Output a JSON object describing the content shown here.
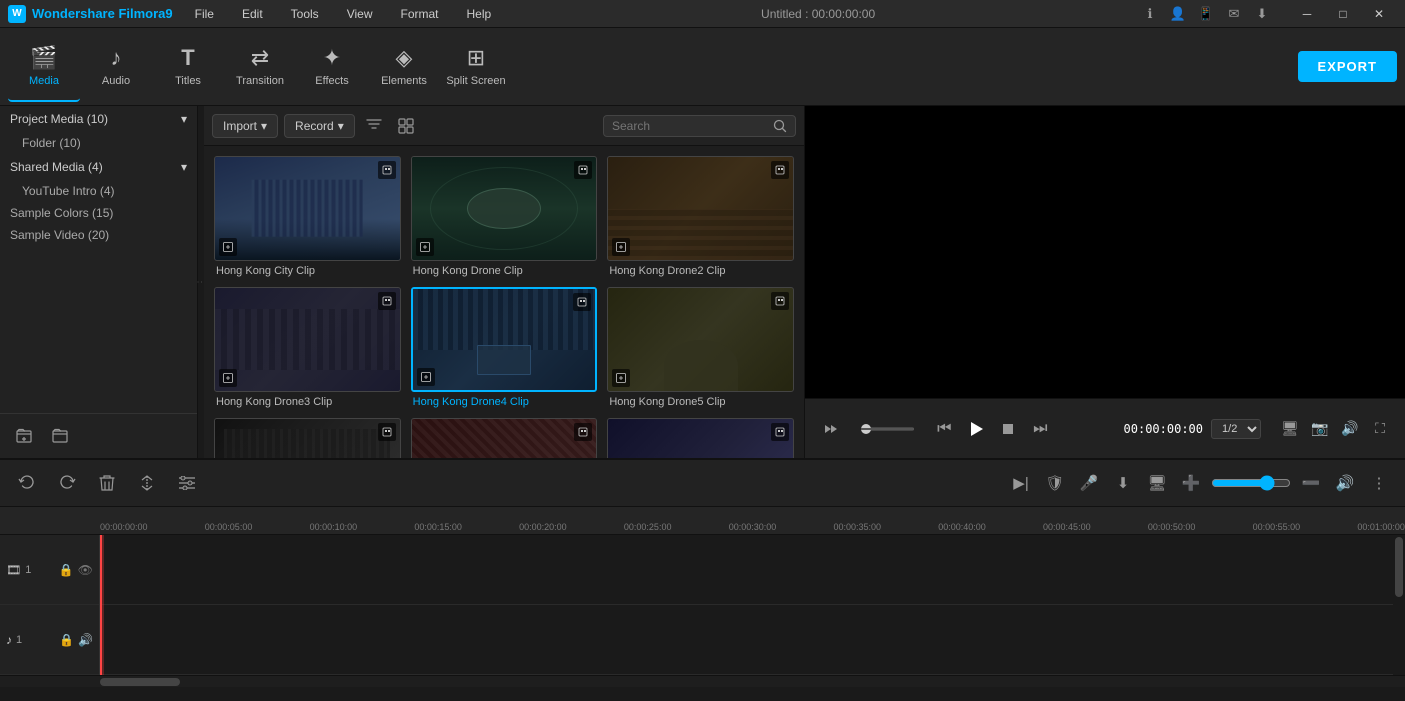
{
  "app": {
    "name": "Wondershare Filmora9",
    "title": "Untitled : 00:00:00:00"
  },
  "menu": {
    "items": [
      "File",
      "Edit",
      "Tools",
      "View",
      "Format",
      "Help"
    ]
  },
  "window_controls": {
    "minimize": "─",
    "maximize": "□",
    "close": "✕"
  },
  "toolbar": {
    "items": [
      {
        "id": "media",
        "label": "Media",
        "icon": "🎬",
        "active": true
      },
      {
        "id": "audio",
        "label": "Audio",
        "icon": "♪",
        "active": false
      },
      {
        "id": "titles",
        "label": "Titles",
        "icon": "T",
        "active": false
      },
      {
        "id": "transition",
        "label": "Transition",
        "icon": "⇄",
        "active": false
      },
      {
        "id": "effects",
        "label": "Effects",
        "icon": "✦",
        "active": false
      },
      {
        "id": "elements",
        "label": "Elements",
        "icon": "◈",
        "active": false
      },
      {
        "id": "splitscreen",
        "label": "Split Screen",
        "icon": "⊞",
        "active": false
      }
    ],
    "export_label": "EXPORT"
  },
  "sidebar": {
    "sections": [
      {
        "id": "project-media",
        "label": "Project Media (10)",
        "expanded": true,
        "sub_items": [
          {
            "id": "folder",
            "label": "Folder (10)"
          }
        ]
      },
      {
        "id": "shared-media",
        "label": "Shared Media (4)",
        "expanded": true,
        "sub_items": [
          {
            "id": "youtube-intro",
            "label": "YouTube Intro (4)"
          }
        ]
      },
      {
        "id": "sample-colors",
        "label": "Sample Colors (15)",
        "expanded": false,
        "sub_items": []
      },
      {
        "id": "sample-video",
        "label": "Sample Video (20)",
        "expanded": false,
        "sub_items": []
      }
    ],
    "footer_btns": [
      {
        "id": "add-folder",
        "icon": "+"
      },
      {
        "id": "remove-folder",
        "icon": "📁"
      }
    ]
  },
  "media_toolbar": {
    "import_label": "Import",
    "record_label": "Record",
    "search_placeholder": "Search",
    "filter_icon": "filter",
    "layout_icon": "grid"
  },
  "media_grid": {
    "items": [
      {
        "id": "city-clip",
        "label": "Hong Kong City Clip",
        "active": false
      },
      {
        "id": "drone-clip",
        "label": "Hong Kong Drone Clip",
        "active": false
      },
      {
        "id": "drone2-clip",
        "label": "Hong Kong Drone2 Clip",
        "active": false
      },
      {
        "id": "drone3-clip",
        "label": "Hong Kong Drone3 Clip",
        "active": false
      },
      {
        "id": "drone4-clip",
        "label": "Hong Kong Drone4 Clip",
        "active": true
      },
      {
        "id": "drone5-clip",
        "label": "Hong Kong Drone5 Clip",
        "active": false
      },
      {
        "id": "row3a",
        "label": "",
        "active": false
      },
      {
        "id": "row3b",
        "label": "",
        "active": false
      },
      {
        "id": "row3c",
        "label": "",
        "active": false
      }
    ]
  },
  "preview": {
    "time": "00:00:00:00",
    "zoom": "1/2",
    "controls": {
      "prev": "⏮",
      "step_back": "⏭",
      "play": "▶",
      "stop": "■",
      "step_fwd": "⏭"
    }
  },
  "action_bar": {
    "undo": "↩",
    "redo": "↪",
    "delete": "🗑",
    "split": "✂",
    "adjust": "≡",
    "right_icons": [
      "▶|",
      "🛡",
      "🎤",
      "⬇",
      "🖥",
      "➕",
      "➖",
      "🔊"
    ]
  },
  "timeline": {
    "ruler_marks": [
      "00:00:00:00",
      "00:00:05:00",
      "00:00:10:00",
      "00:00:15:00",
      "00:00:20:00",
      "00:00:25:00",
      "00:00:30:00",
      "00:00:35:00",
      "00:00:40:00",
      "00:00:45:00",
      "00:00:50:00",
      "00:00:55:00",
      "00:01:00:00"
    ],
    "tracks": [
      {
        "id": "video-1",
        "type": "video",
        "label": "1",
        "icon": "🎞",
        "controls": [
          "🔒",
          "👁"
        ]
      },
      {
        "id": "audio-1",
        "type": "audio",
        "label": "1",
        "icon": "♪",
        "controls": [
          "🔒",
          "🔊"
        ]
      }
    ]
  }
}
